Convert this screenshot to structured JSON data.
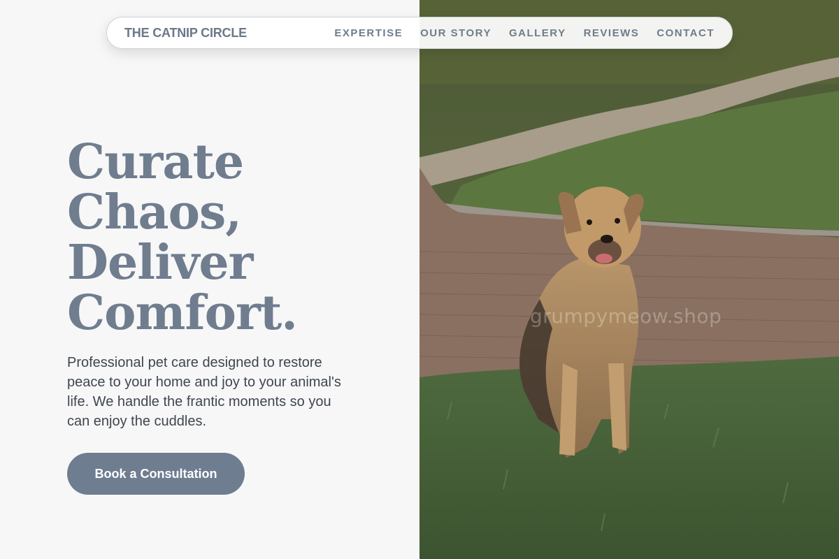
{
  "nav": {
    "brand": "THE CATNIP CIRCLE",
    "links": [
      "EXPERTISE",
      "OUR STORY",
      "GALLERY",
      "REVIEWS",
      "CONTACT"
    ]
  },
  "hero": {
    "title_lines": [
      "Curate",
      "Chaos,",
      "Deliver",
      "Comfort."
    ],
    "description": "Professional pet care designed to restore peace to your home and joy to your animal's life. We handle the frantic moments so you can enjoy the cuddles.",
    "cta_label": "Book a Consultation"
  },
  "photo": {
    "subject": "dog sitting on grass beside brick path",
    "watermark": "grumpymeow.shop"
  },
  "colors": {
    "accent": "#6e7d90",
    "title": "#6f7d8f",
    "background": "#f7f7f7"
  }
}
